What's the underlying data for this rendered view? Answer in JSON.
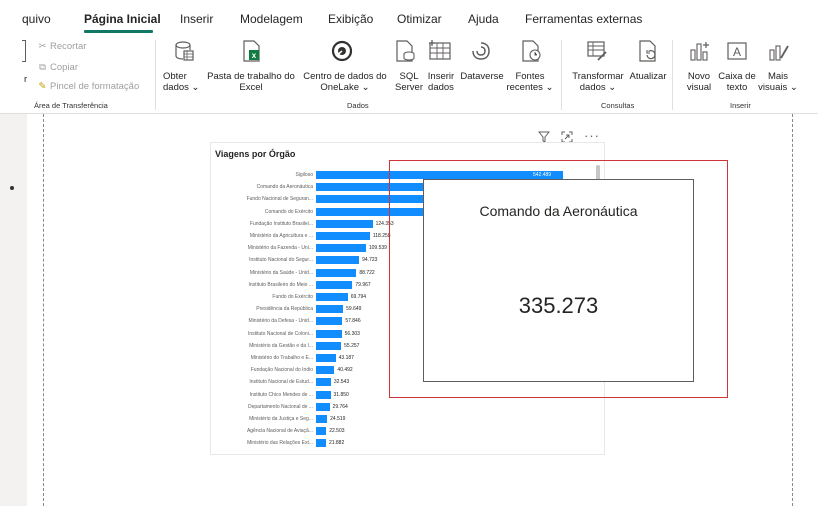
{
  "tabs": [
    {
      "label": "quivo"
    },
    {
      "label": "Página Inicial"
    },
    {
      "label": "Inserir"
    },
    {
      "label": "Modelagem"
    },
    {
      "label": "Exibição"
    },
    {
      "label": "Otimizar"
    },
    {
      "label": "Ajuda"
    },
    {
      "label": "Ferramentas externas"
    }
  ],
  "ribbon": {
    "clipboard": {
      "cut": "Recortar",
      "copy": "Copiar",
      "format_painter": "Pincel de formatação",
      "paste_partial": "r",
      "group": "Área de Transferência"
    },
    "data": {
      "get_data": "Obter\ndados ⌄",
      "excel": "Pasta de trabalho do\nExcel",
      "onelake": "Centro de dados do\nOneLake ⌄",
      "sql": "SQL\nServer",
      "enter_data": "Inserir\ndados",
      "dataverse": "Dataverse",
      "recent": "Fontes\nrecentes ⌄",
      "group": "Dados"
    },
    "queries": {
      "transform": "Transformar\ndados ⌄",
      "refresh": "Atualizar",
      "group": "Consultas"
    },
    "insert": {
      "new_visual": "Novo\nvisual",
      "text_box": "Caixa de\ntexto",
      "more_visuals": "Mais\nvisuais ⌄",
      "group": "Inserir"
    }
  },
  "visual": {
    "title": "Viagens por Órgão",
    "header_icons": [
      "filter-icon",
      "focus-mode-icon",
      "more-options-icon"
    ],
    "more": "···"
  },
  "chart_data": {
    "type": "bar",
    "orientation": "horizontal",
    "title": "Viagens por Órgão",
    "categories": [
      "Sigiloso",
      "Comando da Aeronáutica",
      "Fundo Nacional de Seguran...",
      "Comando do Exército",
      "Fundação Instituto Brasilei...",
      "Ministério da Agricultura e ...",
      "Ministério da Fazenda - Uni...",
      "Instituto Nacional do Segur...",
      "Ministério da Saúde - Unid...",
      "Instituto Brasileiro do Meio ...",
      "Fundo do Exército",
      "Presidência da República",
      "Ministério da Defesa - Unid...",
      "Instituto Nacional de Coloni...",
      "Ministério da Gestão e da I...",
      "Ministério do Trabalho e E...",
      "Fundação Nacional do Índio",
      "Instituto Nacional de Estud...",
      "Instituto Chico Mendes de ...",
      "Departamento Nacional de ...",
      "Ministério da Justiça e Seg...",
      "Agência Nacional de Aviaçã...",
      "Ministério das Relações Ext..."
    ],
    "values": [
      542489,
      335273,
      295000,
      285000,
      124353,
      118258,
      109539,
      94723,
      88722,
      79967,
      69794,
      59649,
      57846,
      56303,
      55257,
      43187,
      40492,
      32543,
      31850,
      29764,
      24519,
      22503,
      21882
    ],
    "value_labels": [
      "542.489",
      "",
      "",
      "",
      "124.353",
      "118.258",
      "109.539",
      "94.723",
      "88.722",
      "79.967",
      "69.794",
      "59.649",
      "57.846",
      "56.303",
      "55.257",
      "43.187",
      "40.492",
      "32.543",
      "31.850",
      "29.764",
      "24.519",
      "22.503",
      "21.882"
    ],
    "bar_color": "#118dff",
    "grid": false,
    "legend": "none"
  },
  "tooltip": {
    "category": "Comando da Aeronáutica",
    "value": "335.273"
  }
}
